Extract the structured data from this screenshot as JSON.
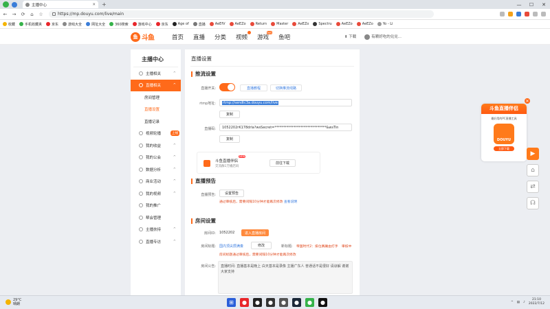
{
  "browser": {
    "tab_title": "主播中心",
    "url": "https://mp.douyu.com/live/main",
    "bookmarks": [
      "收藏",
      "手机收藏夹",
      "京东",
      "游戏大全",
      "网址大全",
      "360搜索",
      "游戏中心",
      "京东",
      "Age of",
      "直播",
      "AeEfV",
      "AeEZo",
      "Return",
      "Master",
      "AeEZo",
      "Spectru",
      "AeEZo",
      "AeEZo",
      "Yo - Li"
    ]
  },
  "site": {
    "logo_text": "斗鱼",
    "nav": [
      "首页",
      "直播",
      "分类",
      "视频",
      "游戏",
      "鱼吧"
    ],
    "nav_badges": {
      "video": "",
      "game": "hot"
    },
    "download": "下载",
    "username": "有颗好吃的兑兑..."
  },
  "sidebar": {
    "title": "主播中心",
    "items": [
      {
        "label": "主播相关",
        "arrow": "^"
      },
      {
        "label": "直播相关",
        "arrow": "^"
      },
      {
        "label": "视频轮播",
        "arrow": ""
      },
      {
        "label": "我的收益",
        "arrow": "^"
      },
      {
        "label": "我的公会",
        "arrow": "^"
      },
      {
        "label": "数据分析",
        "arrow": "^"
      },
      {
        "label": "商业活动",
        "arrow": "^"
      },
      {
        "label": "我的视频",
        "arrow": "^"
      },
      {
        "label": "我的推广",
        "arrow": ""
      },
      {
        "label": "帮会管理",
        "arrow": ""
      },
      {
        "label": "主播扶持",
        "arrow": "^"
      },
      {
        "label": "直播专访",
        "arrow": "^"
      }
    ],
    "subitems": [
      "房间管理",
      "直播设置",
      "直播记录"
    ],
    "new_tag": "上线"
  },
  "content": {
    "page_title": "直播设置",
    "stream_section": "推流设置",
    "live_switch_label": "直播开关:",
    "live_tutorial": "直播教程",
    "switch_line": "切换推流线路",
    "rtmp_label": "rtmp地址:",
    "rtmp_value": "rtmp://sendtc3a.douyu.com/live",
    "copy": "复制",
    "code_label": "直播码:",
    "code_value": "1052202rK178drla?wsSecret=******************************&wsTin",
    "promo_title": "斗鱼直播伴侣",
    "promo_new": "NEW",
    "promo_sub": "交流群1万播店码",
    "promo_btn": "前往下载",
    "preview_section": "直播预告",
    "preview_label": "直播预告:",
    "preview_btn": "设置预告",
    "preview_warn": "通过审核后，需要间隔10分钟才能再次修改",
    "preview_link": "查看说明",
    "room_section": "房间设置",
    "room_id_label": "房间ID:",
    "room_id": "1052202",
    "enter_room": "进入直播房间",
    "room_title_label": "房间标题:",
    "room_title": "国内顶尖攒满奏",
    "modify": "修改",
    "new_title_label": "新标题:",
    "new_title": "帝国时代2：排位赛庸由打手",
    "reviewing": "审核中",
    "title_warn": "房间标题通过审核后，需要间隔10分钟才能再次修改",
    "notice_label": "房间公告:",
    "notice_text": "直播时间: 直播基本是晚上 白天基本是录像 主播广东人 普通话不是很好 请谅解 谢谢大家支持"
  },
  "ad": {
    "title": "斗鱼直播伴侣",
    "sub": "最好用的PC直播工具",
    "logo": "DOUYU",
    "btn": "立即下载"
  },
  "taskbar": {
    "temp": "29°C",
    "weather": "晴朗",
    "time": "21:10",
    "date": "2022/7/12"
  },
  "colors": {
    "accent": "#ff6a1a",
    "link": "#3b7de0",
    "warn": "#e0481c"
  }
}
